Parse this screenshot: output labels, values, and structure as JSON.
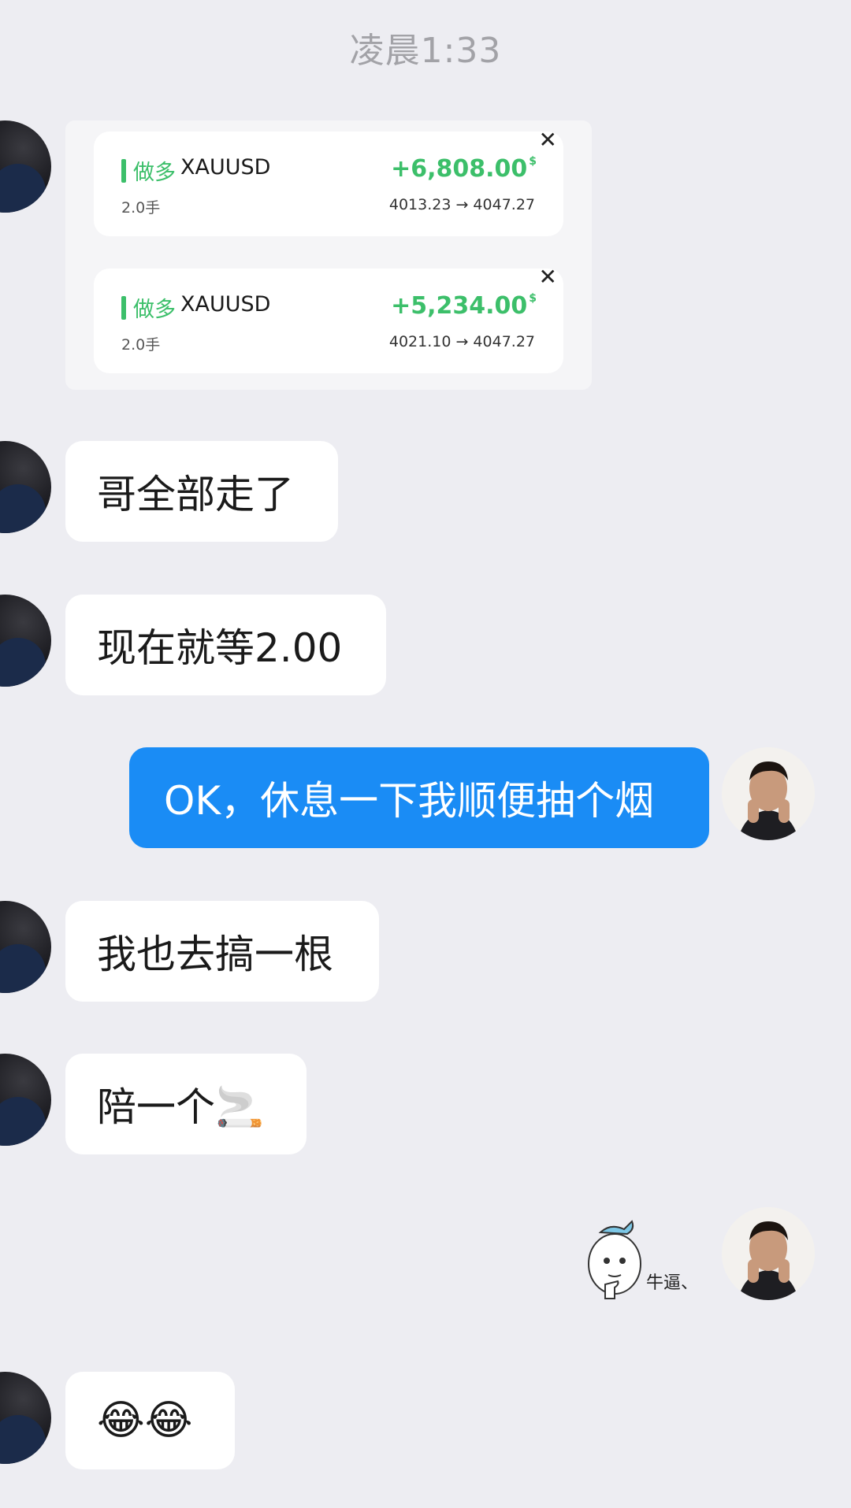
{
  "header": {
    "time": "凌晨1:33"
  },
  "trades": [
    {
      "direction": "做多",
      "symbol": "XAUUSD",
      "profit": "+6,808.00",
      "currency": "$",
      "lots": "2.0手",
      "prices": "4013.23 → 4047.27"
    },
    {
      "direction": "做多",
      "symbol": "XAUUSD",
      "profit": "+5,234.00",
      "currency": "$",
      "lots": "2.0手",
      "prices": "4021.10 → 4047.27"
    }
  ],
  "messages": {
    "m1": "哥全部走了",
    "m2": "现在就等2.00",
    "m3": "OK，休息一下我顺便抽个烟",
    "m4": "我也去搞一根",
    "m5": "陪一个🚬",
    "m6": "😂😂"
  },
  "sticker": {
    "caption": "牛逼、"
  },
  "icons": {
    "close": "close-icon",
    "cigarette": "cigarette-emoji",
    "laugh": "tears-of-joy-emoji"
  },
  "colors": {
    "background": "#ededf2",
    "bubble_self": "#1a8cf5",
    "profit_green": "#3cbf6a"
  }
}
